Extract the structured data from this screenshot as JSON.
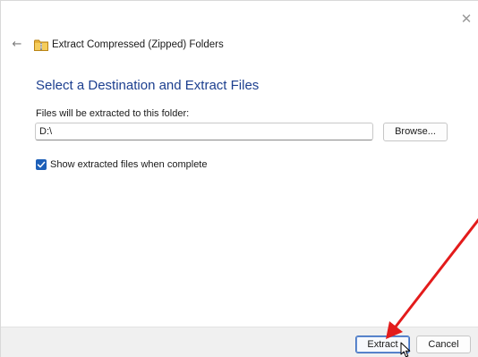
{
  "window": {
    "title": "Extract Compressed (Zipped) Folders",
    "close_glyph": "✕",
    "back_glyph": "←"
  },
  "main": {
    "heading": "Select a Destination and Extract Files",
    "path_label": "Files will be extracted to this folder:",
    "path_value": "D:\\",
    "browse_label": "Browse...",
    "show_files_checkbox": {
      "label": "Show extracted files when complete",
      "checked": true
    }
  },
  "footer": {
    "extract_label": "Extract",
    "cancel_label": "Cancel"
  },
  "colors": {
    "heading": "#1c3f8f",
    "accent": "#1d5fb8",
    "annotation_arrow": "#e31b1b",
    "footer_bg": "#f0f0f0"
  },
  "icons": {
    "back": "arrow-left-icon",
    "close": "close-icon",
    "zip_folder": "zip-folder-icon",
    "checkmark": "checkmark-icon",
    "pointer": "mouse-pointer-icon"
  }
}
